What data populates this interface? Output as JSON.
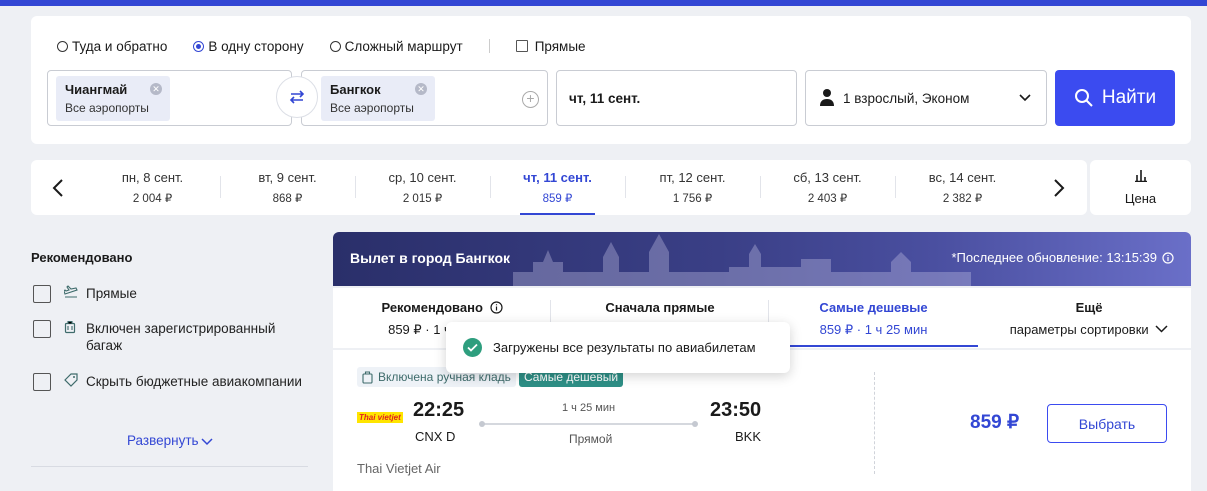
{
  "search": {
    "trip_types": [
      {
        "label": "Туда и обратно",
        "selected": false
      },
      {
        "label": "В одну сторону",
        "selected": true
      },
      {
        "label": "Сложный маршрут",
        "selected": false
      }
    ],
    "direct_label": "Прямые",
    "from": {
      "city": "Чиангмай",
      "sub": "Все аэропорты"
    },
    "to": {
      "city": "Бангкок",
      "sub": "Все аэропорты"
    },
    "date": "чт, 11 сент.",
    "passengers": "1 взрослый, Эконом",
    "find_label": "Найти"
  },
  "dates": [
    {
      "day": "пн, 8 сент.",
      "price": "2 004 ₽"
    },
    {
      "day": "вт, 9 сент.",
      "price": "868 ₽"
    },
    {
      "day": "ср, 10 сент.",
      "price": "2 015 ₽"
    },
    {
      "day": "чт, 11 сент.",
      "price": "859 ₽",
      "active": true
    },
    {
      "day": "пт, 12 сент.",
      "price": "1 756 ₽"
    },
    {
      "day": "сб, 13 сент.",
      "price": "2 403 ₽"
    },
    {
      "day": "вс, 14 сент.",
      "price": "2 382 ₽"
    }
  ],
  "price_chart_label": "Цена",
  "filters": {
    "title": "Рекомендовано",
    "items": [
      "Прямые",
      "Включен зарегистрированный багаж",
      "Скрыть бюджетные авиакомпании"
    ],
    "expand_label": "Развернуть"
  },
  "results": {
    "banner_title": "Вылет в город Бангкок",
    "updated": "*Последнее обновление: 13:15:39",
    "sort_tabs": [
      {
        "title": "Рекомендовано",
        "sub": "859 ₽ · 1 ч 25 мин"
      },
      {
        "title": "Сначала прямые",
        "sub": ""
      },
      {
        "title": "Самые дешевые",
        "sub": "859 ₽ · 1 ч 25 мин",
        "active": true
      },
      {
        "title": "Ещё",
        "sub": "параметры сортировки"
      }
    ],
    "toast": "Загружены все результаты по авиабилетам",
    "flight": {
      "badge_baggage": "Включена ручная кладь",
      "badge_cheapest": "Самые дешевый",
      "logo_text": "Thai vietjet",
      "dep_time": "22:25",
      "dep_code": "CNX D",
      "arr_time": "23:50",
      "arr_code": "BKK",
      "duration": "1 ч 25 мин",
      "stops": "Прямой",
      "airline": "Thai Vietjet Air",
      "price": "859 ₽",
      "select_label": "Выбрать"
    }
  },
  "colors": {
    "accent": "#3347d4",
    "button": "#3b4bf0",
    "cheap_badge": "#2e8f86"
  }
}
